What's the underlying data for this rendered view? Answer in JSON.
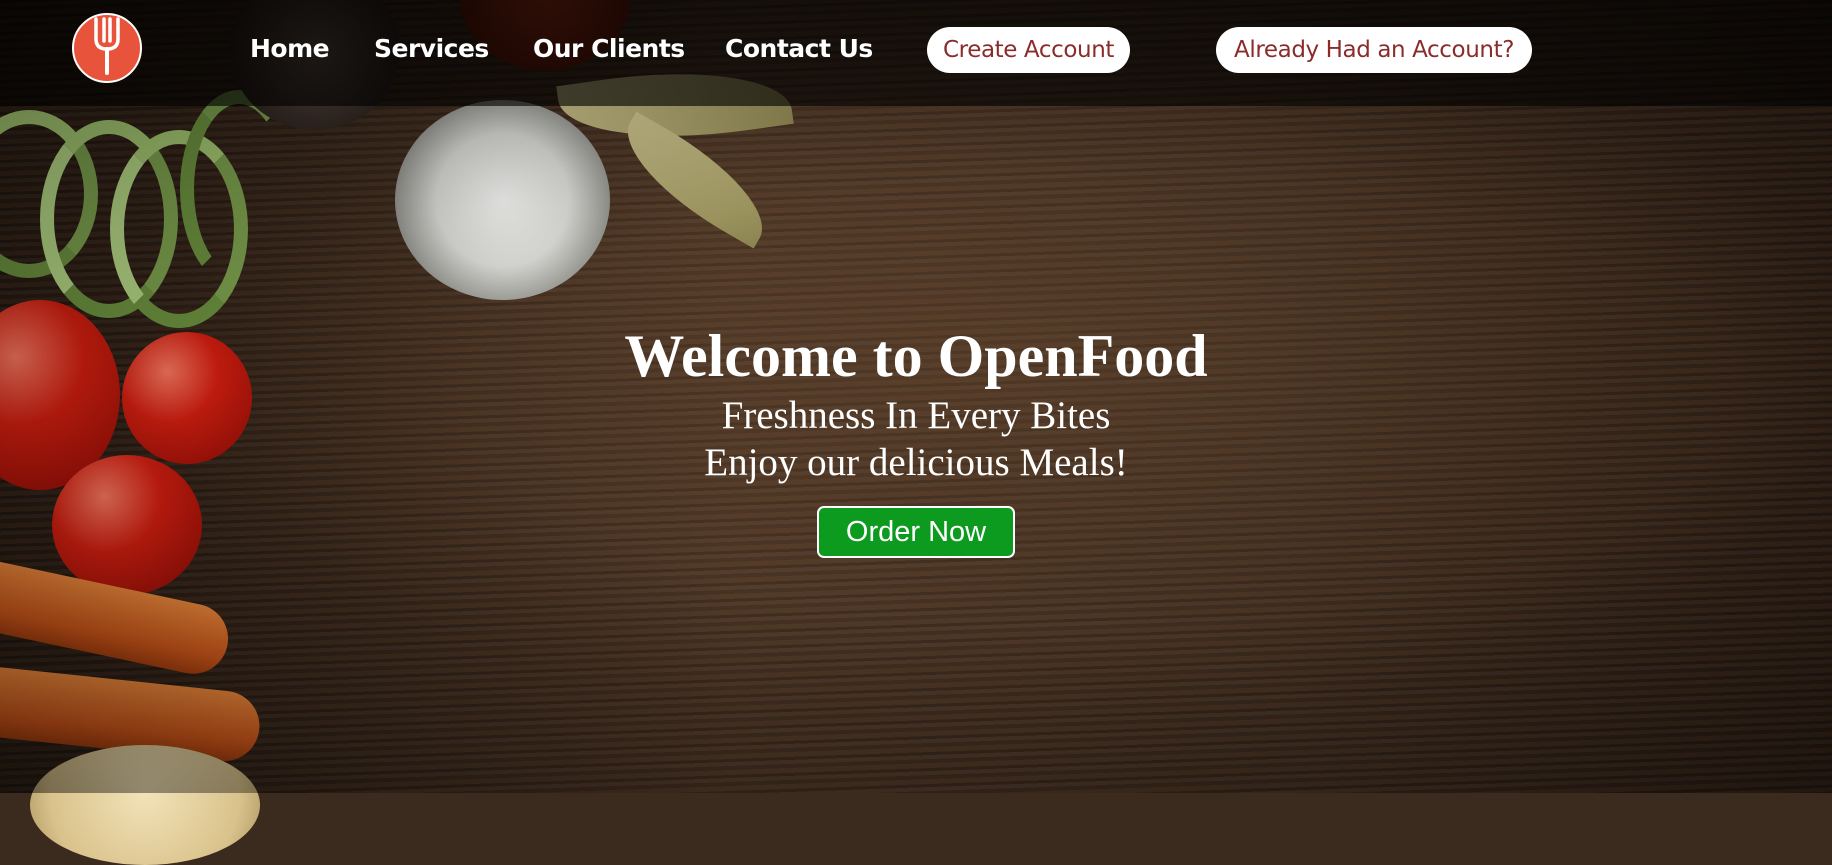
{
  "nav": {
    "logo_icon": "fork-icon",
    "links": [
      "Home",
      "Services",
      "Our Clients",
      "Contact Us"
    ],
    "create_account": "Create Account",
    "login": "Already Had an Account?"
  },
  "hero": {
    "title": "Welcome to OpenFood",
    "subtitle1": "Freshness In Every Bites",
    "subtitle2": "Enjoy our delicious Meals!",
    "order_button": "Order Now"
  },
  "colors": {
    "logo": "#e8543b",
    "pill_text": "#8b2c2c",
    "order_button": "#0c9b1f"
  }
}
